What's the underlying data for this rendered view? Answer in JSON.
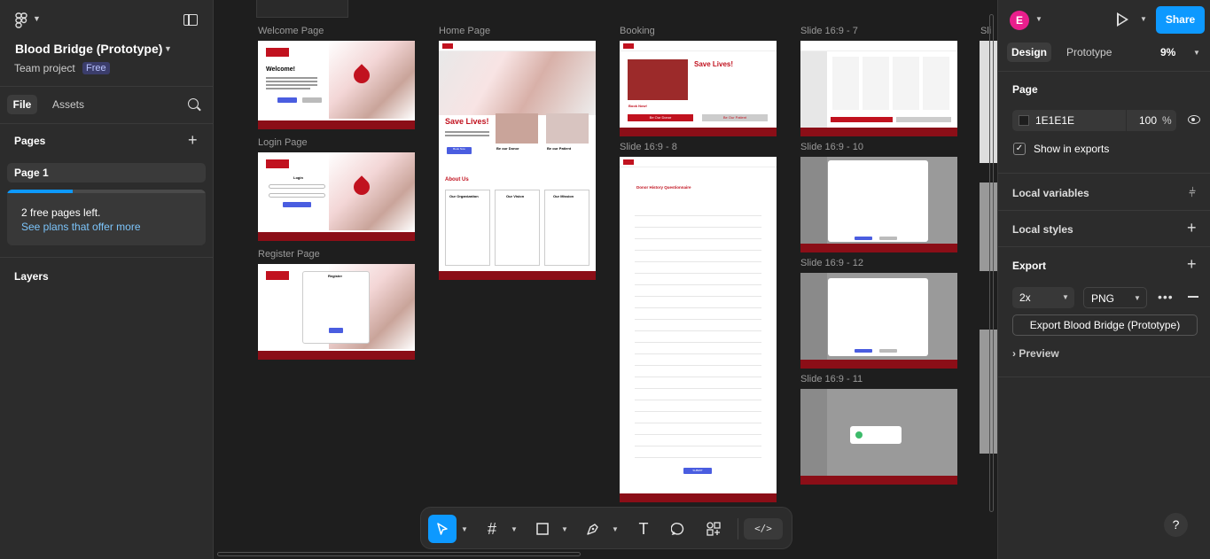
{
  "left_panel": {
    "project_title": "Blood Bridge (Prototype)",
    "team": "Team project",
    "plan_badge": "Free",
    "tabs": [
      "File",
      "Assets"
    ],
    "pages_heading": "Pages",
    "pages": [
      "Page 1"
    ],
    "free_pages_text": "2 free pages left.",
    "free_pages_link": "See plans that offer more",
    "free_pages_used": 0.33,
    "layers_heading": "Layers"
  },
  "canvas": {
    "frames": [
      {
        "label": "Welcome Page",
        "heading": "Welcome!"
      },
      {
        "label": "Login Page",
        "heading": "Login"
      },
      {
        "label": "Register Page",
        "heading": "Register"
      },
      {
        "label": "Home Page",
        "heading": "Save Lives!",
        "button": "Book Now",
        "section": "About Us",
        "cards": [
          "Be our Donor",
          "Be our Patient"
        ],
        "columns": [
          "Our Organization",
          "Our Vision",
          "Our Mission"
        ]
      },
      {
        "label": "Booking",
        "heading": "Save Lives!",
        "sub": "Book Now!",
        "buttons": [
          "Be Our Donor",
          "Be Our Patient"
        ]
      },
      {
        "label": "Slide 16:9 - 8",
        "heading": "Donor History Questionnaire",
        "button": "SUBMIT"
      },
      {
        "label": "Slide 16:9 - 7"
      },
      {
        "label": "Slide 16:9 - 10"
      },
      {
        "label": "Slide 16:9 - 12"
      },
      {
        "label": "Slide 16:9 - 11"
      }
    ],
    "partial_label": "Sli"
  },
  "toolbar": {
    "tools": [
      "move",
      "frame",
      "rectangle",
      "pen",
      "text",
      "comment",
      "actions"
    ],
    "dev_mode_label": "</>"
  },
  "right_panel": {
    "avatar_letter": "E",
    "share_label": "Share",
    "tabs": [
      "Design",
      "Prototype"
    ],
    "zoom": "9%",
    "page_heading": "Page",
    "page_color": "1E1E1E",
    "page_opacity": "100",
    "page_opacity_unit": "%",
    "show_in_exports": "Show in exports",
    "local_variables": "Local variables",
    "local_styles": "Local styles",
    "export_heading": "Export",
    "export_scale": "2x",
    "export_format": "PNG",
    "export_button": "Export Blood Bridge (Prototype)",
    "preview": "Preview",
    "help": "?"
  },
  "colors": {
    "accent": "#0d99ff",
    "brand_red": "#c1121f",
    "footer_red": "#8b0e17"
  }
}
